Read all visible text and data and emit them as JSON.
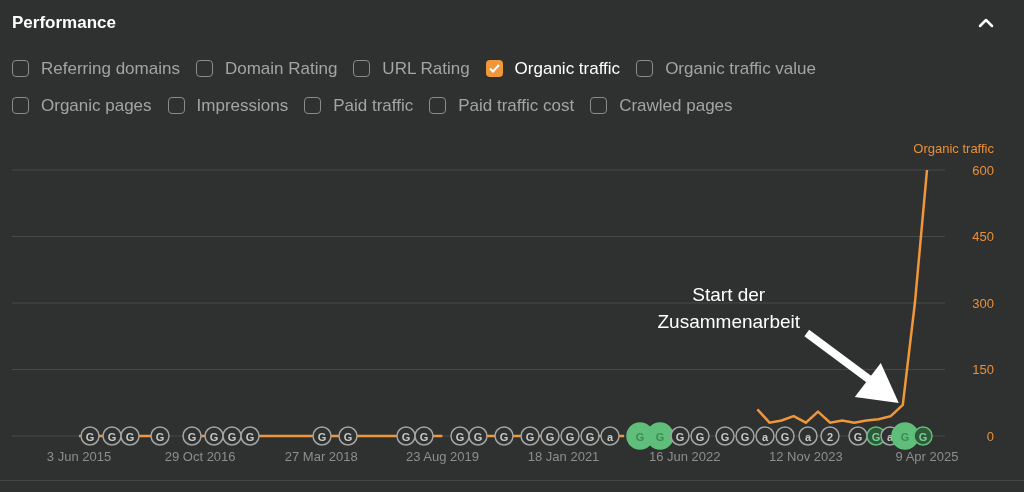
{
  "section": {
    "title": "Performance",
    "expanded": true
  },
  "metrics": [
    [
      {
        "label": "Referring domains",
        "checked": false
      },
      {
        "label": "Domain Rating",
        "checked": false
      },
      {
        "label": "URL Rating",
        "checked": false
      },
      {
        "label": "Organic traffic",
        "checked": true
      },
      {
        "label": "Organic traffic value",
        "checked": false
      }
    ],
    [
      {
        "label": "Organic pages",
        "checked": false
      },
      {
        "label": "Impressions",
        "checked": false
      },
      {
        "label": "Paid traffic",
        "checked": false
      },
      {
        "label": "Paid traffic cost",
        "checked": false
      },
      {
        "label": "Crawled pages",
        "checked": false
      }
    ]
  ],
  "chart": {
    "chart_data": {
      "type": "line",
      "ylim": [
        0,
        600
      ],
      "categories": [
        "3 Jun 2015",
        null,
        null,
        null,
        null,
        null,
        null,
        null,
        null,
        null,
        "29 Oct 2016",
        null,
        null,
        null,
        null,
        null,
        null,
        null,
        null,
        null,
        "27 Mar 2018",
        null,
        null,
        null,
        null,
        null,
        null,
        null,
        null,
        null,
        "23 Aug 2019",
        null,
        null,
        null,
        null,
        null,
        null,
        null,
        null,
        null,
        "18 Jan 2021",
        null,
        null,
        null,
        null,
        null,
        null,
        null,
        null,
        null,
        "16 Jun 2022",
        null,
        null,
        null,
        null,
        null,
        null,
        null,
        null,
        null,
        "12 Nov 2023",
        null,
        null,
        null,
        null,
        null,
        null,
        null,
        null,
        null,
        "9 Apr 2025"
      ],
      "yticks": [
        0,
        150,
        300,
        450,
        600
      ],
      "grid": true,
      "series": [
        {
          "name": "Organic traffic",
          "color": "#f0973a",
          "values": [
            0,
            0,
            0,
            null,
            0,
            0,
            0,
            null,
            null,
            null,
            0,
            0,
            null,
            null,
            0,
            0,
            0,
            0,
            0,
            0,
            0,
            0,
            0,
            0,
            0,
            0,
            0,
            0,
            null,
            0,
            0,
            null,
            null,
            0,
            0,
            0,
            0,
            0,
            0,
            0,
            null,
            null,
            0,
            0,
            0,
            0,
            null,
            null,
            null,
            null,
            null,
            null,
            null,
            null,
            null,
            null,
            60,
            30,
            35,
            45,
            30,
            55,
            30,
            35,
            30,
            35,
            38,
            45,
            70,
            300,
            600
          ]
        }
      ],
      "annotations": [
        "Start der Zusammenarbeit"
      ]
    },
    "markers": [
      {
        "label": "G",
        "kind": "normal"
      },
      {
        "label": "G",
        "kind": "normal"
      },
      {
        "label": "G",
        "kind": "normal"
      },
      {
        "label": "G",
        "kind": "normal"
      },
      {
        "label": "G",
        "kind": "normal"
      },
      {
        "label": "G",
        "kind": "normal"
      },
      {
        "label": "G",
        "kind": "normal"
      },
      {
        "label": "G",
        "kind": "normal"
      },
      {
        "label": "G",
        "kind": "normal"
      },
      {
        "label": "G",
        "kind": "normal"
      },
      {
        "label": "G",
        "kind": "normal"
      },
      {
        "label": "G",
        "kind": "normal"
      },
      {
        "label": "G",
        "kind": "normal"
      },
      {
        "label": "G",
        "kind": "normal"
      },
      {
        "label": "G",
        "kind": "normal"
      },
      {
        "label": "G",
        "kind": "normal"
      },
      {
        "label": "G",
        "kind": "normal"
      },
      {
        "label": "G",
        "kind": "normal"
      },
      {
        "label": "G",
        "kind": "normal"
      },
      {
        "label": "a",
        "kind": "normal"
      },
      {
        "label": "G",
        "kind": "major"
      },
      {
        "label": "G",
        "kind": "major"
      },
      {
        "label": "G",
        "kind": "normal"
      },
      {
        "label": "G",
        "kind": "normal"
      },
      {
        "label": "G",
        "kind": "normal"
      },
      {
        "label": "G",
        "kind": "normal"
      },
      {
        "label": "a",
        "kind": "normal"
      },
      {
        "label": "G",
        "kind": "normal"
      },
      {
        "label": "a",
        "kind": "normal"
      },
      {
        "label": "2",
        "kind": "normal"
      },
      {
        "label": "G",
        "kind": "normal"
      },
      {
        "label": "G",
        "kind": "minor"
      },
      {
        "label": "a",
        "kind": "normal"
      },
      {
        "label": "G",
        "kind": "major"
      },
      {
        "label": "G",
        "kind": "minor"
      }
    ]
  }
}
